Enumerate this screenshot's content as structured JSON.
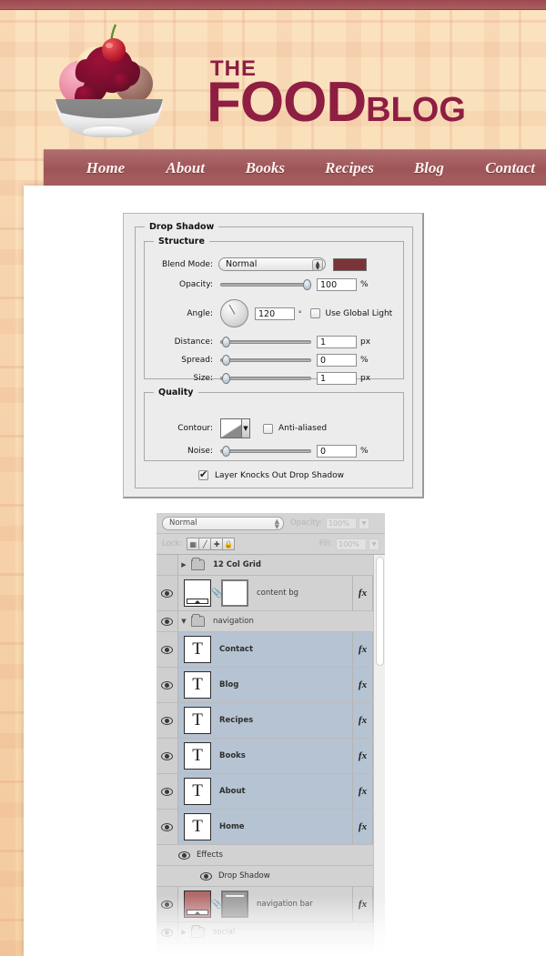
{
  "site": {
    "logo_text_small": "THE",
    "logo_text_main": "FOOD",
    "logo_text_sub": "BLOG",
    "logo_icon": "ice-cream-sundae-icon",
    "brand_color": "#8e1e42",
    "nav_bar_color": "#9d5558",
    "background_color": "#f9dcb4",
    "nav": [
      {
        "label": "Home"
      },
      {
        "label": "About"
      },
      {
        "label": "Books"
      },
      {
        "label": "Recipes"
      },
      {
        "label": "Blog"
      },
      {
        "label": "Contact"
      }
    ]
  },
  "dialog": {
    "title": "Drop Shadow",
    "structure": {
      "title": "Structure",
      "blend_mode_label": "Blend Mode:",
      "blend_mode_value": "Normal",
      "shadow_color": "#7b3337",
      "opacity_label": "Opacity:",
      "opacity_value": "100",
      "opacity_unit": "%",
      "angle_label": "Angle:",
      "angle_value": "120",
      "angle_unit": "°",
      "use_global_light_label": "Use Global Light",
      "use_global_light_checked": false,
      "distance_label": "Distance:",
      "distance_value": "1",
      "distance_unit": "px",
      "spread_label": "Spread:",
      "spread_value": "0",
      "spread_unit": "%",
      "size_label": "Size:",
      "size_value": "1",
      "size_unit": "px"
    },
    "quality": {
      "title": "Quality",
      "contour_label": "Contour:",
      "anti_aliased_label": "Anti-aliased",
      "anti_aliased_checked": false,
      "noise_label": "Noise:",
      "noise_value": "0",
      "noise_unit": "%"
    },
    "knockout_label": "Layer Knocks Out Drop Shadow",
    "knockout_checked": true
  },
  "layers_panel": {
    "blend_mode": "Normal",
    "opacity_label": "Opacity:",
    "opacity_value": "100%",
    "lock_label": "Lock:",
    "lock_buttons": [
      {
        "icon": "transparency-lock-icon"
      },
      {
        "icon": "paintbrush-lock-icon"
      },
      {
        "icon": "move-lock-icon"
      },
      {
        "icon": "lock-all-icon"
      }
    ],
    "fill_label": "Fill:",
    "fill_value": "100%",
    "rows": [
      {
        "type": "group",
        "name": "12 Col Grid",
        "visible": false,
        "expanded": false,
        "selected": false,
        "fx": false
      },
      {
        "type": "layer",
        "name": "content bg",
        "visible": true,
        "selected": false,
        "fx": true,
        "thumb": "white-bar",
        "mask": "white"
      },
      {
        "type": "group",
        "name": "navigation",
        "visible": true,
        "expanded": true,
        "selected": false,
        "fx": false
      },
      {
        "type": "text",
        "name": "Contact",
        "visible": true,
        "selected": true,
        "fx": true,
        "thumb_glyph": "T"
      },
      {
        "type": "text",
        "name": "Blog",
        "visible": true,
        "selected": true,
        "fx": true,
        "thumb_glyph": "T"
      },
      {
        "type": "text",
        "name": "Recipes",
        "visible": true,
        "selected": true,
        "fx": true,
        "thumb_glyph": "T"
      },
      {
        "type": "text",
        "name": "Books",
        "visible": true,
        "selected": true,
        "fx": true,
        "thumb_glyph": "T"
      },
      {
        "type": "text",
        "name": "About",
        "visible": true,
        "selected": true,
        "fx": true,
        "thumb_glyph": "T"
      },
      {
        "type": "text",
        "name": "Home",
        "visible": true,
        "selected": true,
        "fx": true,
        "thumb_glyph": "T",
        "expanded_fx": true
      },
      {
        "type": "effects",
        "name": "Effects",
        "visible": true
      },
      {
        "type": "effect",
        "name": "Drop Shadow",
        "visible": true
      },
      {
        "type": "layer",
        "name": "navigation bar",
        "visible": true,
        "selected": false,
        "fx": true,
        "thumb": "color",
        "thumb_color": "#b36a6a",
        "mask": "gray"
      },
      {
        "type": "group",
        "name": "social",
        "visible": true,
        "expanded": false,
        "selected": false,
        "fx": false,
        "faded": true
      }
    ]
  }
}
